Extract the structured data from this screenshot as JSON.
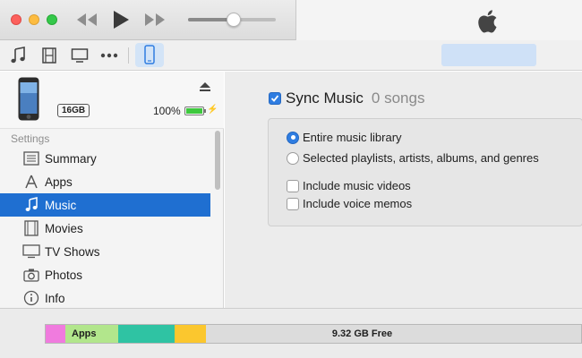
{
  "titlebar": {
    "controls": [
      "close",
      "minimize",
      "zoom"
    ],
    "transport_icons": [
      "rewind-icon",
      "play-icon",
      "fast-forward-icon"
    ],
    "volume_level": 0.53,
    "logo": "apple-logo"
  },
  "toolbar": {
    "items": [
      "music-note-icon",
      "film-icon",
      "tv-icon",
      "more-icon",
      "iphone-icon"
    ],
    "selected": "iphone-icon"
  },
  "device": {
    "capacity": "16GB",
    "battery": "100%",
    "battery_level": 1.0
  },
  "sidebar": {
    "section_label": "Settings",
    "items": [
      {
        "label": "Summary",
        "icon": "summary-icon"
      },
      {
        "label": "Apps",
        "icon": "apps-icon"
      },
      {
        "label": "Music",
        "icon": "music-note-icon"
      },
      {
        "label": "Movies",
        "icon": "film-icon"
      },
      {
        "label": "TV Shows",
        "icon": "tv-icon"
      },
      {
        "label": "Photos",
        "icon": "camera-icon"
      },
      {
        "label": "Info",
        "icon": "info-icon"
      }
    ],
    "active": "Music"
  },
  "main": {
    "sync_label": "Sync Music",
    "sync_count": "0 songs",
    "sync_checked": true,
    "radio_entire": "Entire music library",
    "radio_selected": "Selected playlists, artists, albums, and genres",
    "check_videos": "Include music videos",
    "check_memos": "Include voice memos"
  },
  "storage": {
    "apps_label": "Apps",
    "free_label": "9.32 GB Free",
    "colors": {
      "other": "#f07bde",
      "apps": "#b2e68c",
      "documents": "#2fc3a3",
      "misc": "#fbc72e",
      "free": "#dcdcdc"
    }
  },
  "colors": {
    "accent": "#1f6fd1",
    "checkbox": "#2f7de1"
  }
}
